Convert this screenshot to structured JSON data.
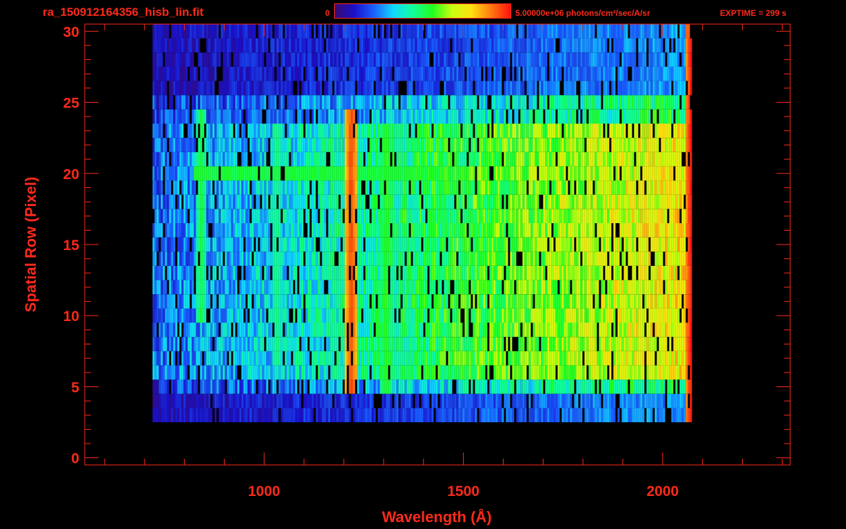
{
  "header": {
    "file_title": "ra_150912164356_hisb_lin.fit",
    "colorbar_min": "0",
    "colorbar_max": "5.00000e+06 photons/cm²/sec/A/sr",
    "exptime": "EXPTIME = 299 s"
  },
  "colors": {
    "axis": "#ff2a1a",
    "background": "#000000",
    "colormap": [
      "#000000",
      "#3a0a6e",
      "#1a10c8",
      "#1a60ff",
      "#10d8ff",
      "#10ff9a",
      "#20ff20",
      "#c8ff10",
      "#ffe010",
      "#ff7a10",
      "#ff1010"
    ]
  },
  "chart_data": {
    "type": "heatmap",
    "xlabel": "Wavelength (Å)",
    "ylabel": "Spatial Row (Pixel)",
    "xlim": [
      550,
      2320
    ],
    "ylim": [
      -0.5,
      30.5
    ],
    "x_ticks": [
      1000,
      1500,
      2000
    ],
    "y_ticks": [
      0,
      5,
      10,
      15,
      20,
      25,
      30
    ],
    "colorbar_range": [
      0,
      5000000
    ],
    "colorbar_units": "photons/cm²/sec/A/sr",
    "signal_extent": {
      "x": [
        720,
        2070
      ],
      "rows": [
        3,
        30
      ]
    },
    "features": [
      {
        "name": "",
        "x": 1216,
        "rows": [
          5,
          24
        ],
        "level": 0.92
      },
      {
        "name": "",
        "x": 1304,
        "rows": [
          5,
          23
        ],
        "level": 0.55
      },
      {
        "name": "",
        "x": 1030,
        "rows": [
          7,
          23
        ],
        "level": 0.45
      },
      {
        "name": "",
        "x": 840,
        "rows": [
          10,
          24
        ],
        "level": 0.5
      },
      {
        "name": "",
        "x": 1810,
        "rows": [
          6,
          23
        ],
        "level": 0.5
      },
      {
        "name": "",
        "x": 2070,
        "rows": [
          2,
          30
        ],
        "level": 0.98
      }
    ],
    "bright_row": {
      "row": 20,
      "x": [
        820,
        2070
      ],
      "level": 0.5
    },
    "grid": false
  }
}
